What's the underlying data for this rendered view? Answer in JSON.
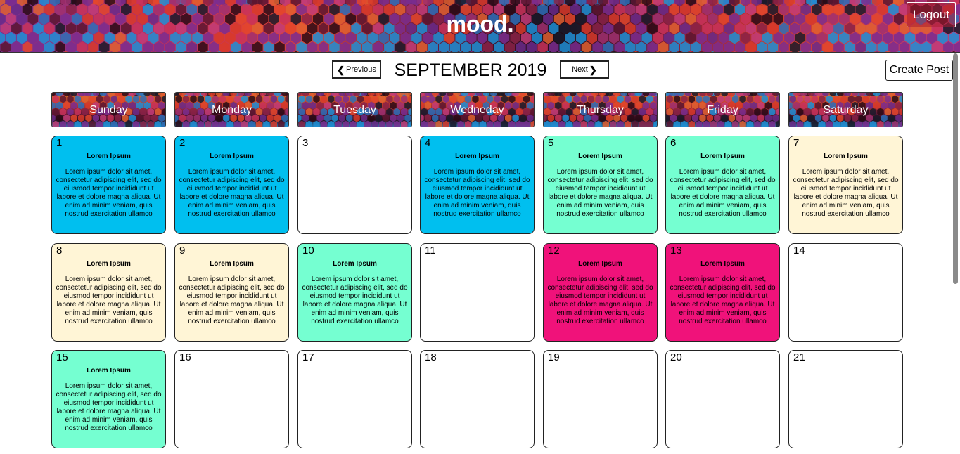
{
  "header": {
    "brand": "mood.",
    "logout_label": "Logout"
  },
  "toolbar": {
    "prev_label": "Previous",
    "next_label": "Next",
    "month_title": "SEPTEMBER 2019",
    "create_label": "Create Post"
  },
  "weekdays": [
    "Sunday",
    "Monday",
    "Tuesday",
    "Wedneday",
    "Thursday",
    "Friday",
    "Saturday"
  ],
  "mood_colors": {
    "blue": "#00bfef",
    "mint": "#75ffd1",
    "cream": "#fff5d6",
    "pink": "#f0127a",
    "none": "#ffffff"
  },
  "days": [
    {
      "day": "1",
      "mood": "blue",
      "title": "Lorem Ipsum",
      "body": "Lorem ipsum dolor sit amet, consectetur adipiscing elit, sed do eiusmod tempor incididunt ut labore et dolore magna aliqua. Ut enim ad minim veniam, quis nostrud exercitation ullamco"
    },
    {
      "day": "2",
      "mood": "blue",
      "title": "Lorem Ipsum",
      "body": "Lorem ipsum dolor sit amet, consectetur adipiscing elit, sed do eiusmod tempor incididunt ut labore et dolore magna aliqua. Ut enim ad minim veniam, quis nostrud exercitation ullamco"
    },
    {
      "day": "3",
      "mood": "none",
      "title": "",
      "body": ""
    },
    {
      "day": "4",
      "mood": "blue",
      "title": "Lorem Ipsum",
      "body": "Lorem ipsum dolor sit amet, consectetur adipiscing elit, sed do eiusmod tempor incididunt ut labore et dolore magna aliqua. Ut enim ad minim veniam, quis nostrud exercitation ullamco"
    },
    {
      "day": "5",
      "mood": "mint",
      "title": "Lorem Ipsum",
      "body": "Lorem ipsum dolor sit amet, consectetur adipiscing elit, sed do eiusmod tempor incididunt ut labore et dolore magna aliqua. Ut enim ad minim veniam, quis nostrud exercitation ullamco"
    },
    {
      "day": "6",
      "mood": "mint",
      "title": "Lorem Ipsum",
      "body": "Lorem ipsum dolor sit amet, consectetur adipiscing elit, sed do eiusmod tempor incididunt ut labore et dolore magna aliqua. Ut enim ad minim veniam, quis nostrud exercitation ullamco"
    },
    {
      "day": "7",
      "mood": "cream",
      "title": "Lorem Ipsum",
      "body": "Lorem ipsum dolor sit amet, consectetur adipiscing elit, sed do eiusmod tempor incididunt ut labore et dolore magna aliqua. Ut enim ad minim veniam, quis nostrud exercitation ullamco"
    },
    {
      "day": "8",
      "mood": "cream",
      "title": "Lorem Ipsum",
      "body": "Lorem ipsum dolor sit amet, consectetur adipiscing elit, sed do eiusmod tempor incididunt ut labore et dolore magna aliqua. Ut enim ad minim veniam, quis nostrud exercitation ullamco"
    },
    {
      "day": "9",
      "mood": "cream",
      "title": "Lorem Ipsum",
      "body": "Lorem ipsum dolor sit amet, consectetur adipiscing elit, sed do eiusmod tempor incididunt ut labore et dolore magna aliqua. Ut enim ad minim veniam, quis nostrud exercitation ullamco"
    },
    {
      "day": "10",
      "mood": "mint",
      "title": "Lorem Ipsum",
      "body": "Lorem ipsum dolor sit amet, consectetur adipiscing elit, sed do eiusmod tempor incididunt ut labore et dolore magna aliqua. Ut enim ad minim veniam, quis nostrud exercitation ullamco"
    },
    {
      "day": "11",
      "mood": "none",
      "title": "",
      "body": ""
    },
    {
      "day": "12",
      "mood": "pink",
      "title": "Lorem Ipsum",
      "body": "Lorem ipsum dolor sit amet, consectetur adipiscing elit, sed do eiusmod tempor incididunt ut labore et dolore magna aliqua. Ut enim ad minim veniam, quis nostrud exercitation ullamco"
    },
    {
      "day": "13",
      "mood": "pink",
      "title": "Lorem Ipsum",
      "body": "Lorem ipsum dolor sit amet, consectetur adipiscing elit, sed do eiusmod tempor incididunt ut labore et dolore magna aliqua. Ut enim ad minim veniam, quis nostrud exercitation ullamco"
    },
    {
      "day": "14",
      "mood": "none",
      "title": "",
      "body": ""
    },
    {
      "day": "15",
      "mood": "mint",
      "title": "Lorem Ipsum",
      "body": "Lorem ipsum dolor sit amet, consectetur adipiscing elit, sed do eiusmod tempor incididunt ut labore et dolore magna aliqua. Ut enim ad minim veniam, quis nostrud exercitation ullamco"
    },
    {
      "day": "16",
      "mood": "none",
      "title": "",
      "body": ""
    },
    {
      "day": "17",
      "mood": "none",
      "title": "",
      "body": ""
    },
    {
      "day": "18",
      "mood": "none",
      "title": "",
      "body": ""
    },
    {
      "day": "19",
      "mood": "none",
      "title": "",
      "body": ""
    },
    {
      "day": "20",
      "mood": "none",
      "title": "",
      "body": ""
    },
    {
      "day": "21",
      "mood": "none",
      "title": "",
      "body": ""
    }
  ]
}
